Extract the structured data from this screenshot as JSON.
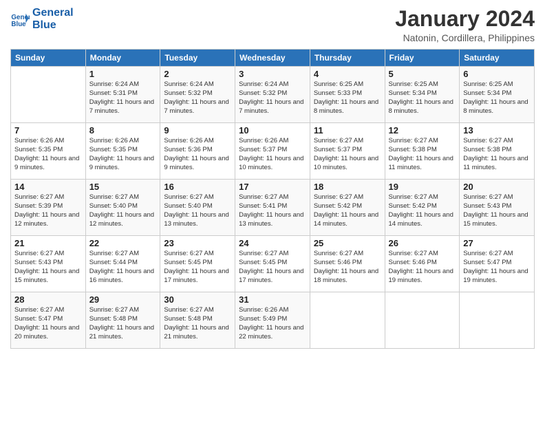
{
  "logo": {
    "line1": "General",
    "line2": "Blue"
  },
  "title": "January 2024",
  "subtitle": "Natonin, Cordillera, Philippines",
  "days_of_week": [
    "Sunday",
    "Monday",
    "Tuesday",
    "Wednesday",
    "Thursday",
    "Friday",
    "Saturday"
  ],
  "weeks": [
    [
      {
        "day": "",
        "sunrise": "",
        "sunset": "",
        "daylight": ""
      },
      {
        "day": "1",
        "sunrise": "Sunrise: 6:24 AM",
        "sunset": "Sunset: 5:31 PM",
        "daylight": "Daylight: 11 hours and 7 minutes."
      },
      {
        "day": "2",
        "sunrise": "Sunrise: 6:24 AM",
        "sunset": "Sunset: 5:32 PM",
        "daylight": "Daylight: 11 hours and 7 minutes."
      },
      {
        "day": "3",
        "sunrise": "Sunrise: 6:24 AM",
        "sunset": "Sunset: 5:32 PM",
        "daylight": "Daylight: 11 hours and 7 minutes."
      },
      {
        "day": "4",
        "sunrise": "Sunrise: 6:25 AM",
        "sunset": "Sunset: 5:33 PM",
        "daylight": "Daylight: 11 hours and 8 minutes."
      },
      {
        "day": "5",
        "sunrise": "Sunrise: 6:25 AM",
        "sunset": "Sunset: 5:34 PM",
        "daylight": "Daylight: 11 hours and 8 minutes."
      },
      {
        "day": "6",
        "sunrise": "Sunrise: 6:25 AM",
        "sunset": "Sunset: 5:34 PM",
        "daylight": "Daylight: 11 hours and 8 minutes."
      }
    ],
    [
      {
        "day": "7",
        "sunrise": "Sunrise: 6:26 AM",
        "sunset": "Sunset: 5:35 PM",
        "daylight": "Daylight: 11 hours and 9 minutes."
      },
      {
        "day": "8",
        "sunrise": "Sunrise: 6:26 AM",
        "sunset": "Sunset: 5:35 PM",
        "daylight": "Daylight: 11 hours and 9 minutes."
      },
      {
        "day": "9",
        "sunrise": "Sunrise: 6:26 AM",
        "sunset": "Sunset: 5:36 PM",
        "daylight": "Daylight: 11 hours and 9 minutes."
      },
      {
        "day": "10",
        "sunrise": "Sunrise: 6:26 AM",
        "sunset": "Sunset: 5:37 PM",
        "daylight": "Daylight: 11 hours and 10 minutes."
      },
      {
        "day": "11",
        "sunrise": "Sunrise: 6:27 AM",
        "sunset": "Sunset: 5:37 PM",
        "daylight": "Daylight: 11 hours and 10 minutes."
      },
      {
        "day": "12",
        "sunrise": "Sunrise: 6:27 AM",
        "sunset": "Sunset: 5:38 PM",
        "daylight": "Daylight: 11 hours and 11 minutes."
      },
      {
        "day": "13",
        "sunrise": "Sunrise: 6:27 AM",
        "sunset": "Sunset: 5:38 PM",
        "daylight": "Daylight: 11 hours and 11 minutes."
      }
    ],
    [
      {
        "day": "14",
        "sunrise": "Sunrise: 6:27 AM",
        "sunset": "Sunset: 5:39 PM",
        "daylight": "Daylight: 11 hours and 12 minutes."
      },
      {
        "day": "15",
        "sunrise": "Sunrise: 6:27 AM",
        "sunset": "Sunset: 5:40 PM",
        "daylight": "Daylight: 11 hours and 12 minutes."
      },
      {
        "day": "16",
        "sunrise": "Sunrise: 6:27 AM",
        "sunset": "Sunset: 5:40 PM",
        "daylight": "Daylight: 11 hours and 13 minutes."
      },
      {
        "day": "17",
        "sunrise": "Sunrise: 6:27 AM",
        "sunset": "Sunset: 5:41 PM",
        "daylight": "Daylight: 11 hours and 13 minutes."
      },
      {
        "day": "18",
        "sunrise": "Sunrise: 6:27 AM",
        "sunset": "Sunset: 5:42 PM",
        "daylight": "Daylight: 11 hours and 14 minutes."
      },
      {
        "day": "19",
        "sunrise": "Sunrise: 6:27 AM",
        "sunset": "Sunset: 5:42 PM",
        "daylight": "Daylight: 11 hours and 14 minutes."
      },
      {
        "day": "20",
        "sunrise": "Sunrise: 6:27 AM",
        "sunset": "Sunset: 5:43 PM",
        "daylight": "Daylight: 11 hours and 15 minutes."
      }
    ],
    [
      {
        "day": "21",
        "sunrise": "Sunrise: 6:27 AM",
        "sunset": "Sunset: 5:43 PM",
        "daylight": "Daylight: 11 hours and 15 minutes."
      },
      {
        "day": "22",
        "sunrise": "Sunrise: 6:27 AM",
        "sunset": "Sunset: 5:44 PM",
        "daylight": "Daylight: 11 hours and 16 minutes."
      },
      {
        "day": "23",
        "sunrise": "Sunrise: 6:27 AM",
        "sunset": "Sunset: 5:45 PM",
        "daylight": "Daylight: 11 hours and 17 minutes."
      },
      {
        "day": "24",
        "sunrise": "Sunrise: 6:27 AM",
        "sunset": "Sunset: 5:45 PM",
        "daylight": "Daylight: 11 hours and 17 minutes."
      },
      {
        "day": "25",
        "sunrise": "Sunrise: 6:27 AM",
        "sunset": "Sunset: 5:46 PM",
        "daylight": "Daylight: 11 hours and 18 minutes."
      },
      {
        "day": "26",
        "sunrise": "Sunrise: 6:27 AM",
        "sunset": "Sunset: 5:46 PM",
        "daylight": "Daylight: 11 hours and 19 minutes."
      },
      {
        "day": "27",
        "sunrise": "Sunrise: 6:27 AM",
        "sunset": "Sunset: 5:47 PM",
        "daylight": "Daylight: 11 hours and 19 minutes."
      }
    ],
    [
      {
        "day": "28",
        "sunrise": "Sunrise: 6:27 AM",
        "sunset": "Sunset: 5:47 PM",
        "daylight": "Daylight: 11 hours and 20 minutes."
      },
      {
        "day": "29",
        "sunrise": "Sunrise: 6:27 AM",
        "sunset": "Sunset: 5:48 PM",
        "daylight": "Daylight: 11 hours and 21 minutes."
      },
      {
        "day": "30",
        "sunrise": "Sunrise: 6:27 AM",
        "sunset": "Sunset: 5:48 PM",
        "daylight": "Daylight: 11 hours and 21 minutes."
      },
      {
        "day": "31",
        "sunrise": "Sunrise: 6:26 AM",
        "sunset": "Sunset: 5:49 PM",
        "daylight": "Daylight: 11 hours and 22 minutes."
      },
      {
        "day": "",
        "sunrise": "",
        "sunset": "",
        "daylight": ""
      },
      {
        "day": "",
        "sunrise": "",
        "sunset": "",
        "daylight": ""
      },
      {
        "day": "",
        "sunrise": "",
        "sunset": "",
        "daylight": ""
      }
    ]
  ]
}
